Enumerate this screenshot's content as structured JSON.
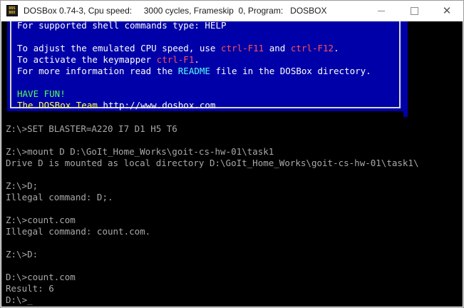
{
  "window": {
    "title": "DOSBox 0.74-3, Cpu speed:     3000 cycles, Frameskip  0, Program:   DOSBOX",
    "icon_label_top": "DOS",
    "icon_label_bottom": "BOX",
    "icon": "dosbox-app-icon",
    "controls": [
      "minimize-icon",
      "maximize-icon",
      "close-icon"
    ]
  },
  "banner": {
    "lines": [
      {
        "segments": [
          {
            "text": "For supported shell commands type: HELP",
            "color": "white"
          }
        ]
      },
      {
        "segments": []
      },
      {
        "segments": [
          {
            "text": "To adjust the emulated CPU speed, use ",
            "color": "white"
          },
          {
            "text": "ctrl-F11",
            "color": "red"
          },
          {
            "text": " and ",
            "color": "white"
          },
          {
            "text": "ctrl-F12",
            "color": "red"
          },
          {
            "text": ".",
            "color": "white"
          }
        ]
      },
      {
        "segments": [
          {
            "text": "To activate the keymapper ",
            "color": "white"
          },
          {
            "text": "ctrl-F1",
            "color": "red"
          },
          {
            "text": ".",
            "color": "white"
          }
        ]
      },
      {
        "segments": [
          {
            "text": "For more information read the ",
            "color": "white"
          },
          {
            "text": "README",
            "color": "cyan"
          },
          {
            "text": " file in the DOSBox directory.",
            "color": "white"
          }
        ]
      },
      {
        "segments": []
      },
      {
        "segments": [
          {
            "text": "HAVE FUN!",
            "color": "green"
          }
        ]
      },
      {
        "segments": [
          {
            "text": "The DOSBox Team ",
            "color": "yellow"
          },
          {
            "text": "http://www.dosbox.com",
            "color": "white"
          }
        ]
      }
    ]
  },
  "console": {
    "lines": [
      "Z:\\>SET BLASTER=A220 I7 D1 H5 T6",
      "",
      "Z:\\>mount D D:\\GoIt_Home_Works\\goit-cs-hw-01\\task1",
      "Drive D is mounted as local directory D:\\GoIt_Home_Works\\goit-cs-hw-01\\task1\\",
      "",
      "Z:\\>D;",
      "Illegal command: D;.",
      "",
      "Z:\\>count.com",
      "Illegal command: count.com.",
      "",
      "Z:\\>D:",
      "",
      "D:\\>count.com",
      "Result: 6",
      "D:\\>"
    ],
    "cursor": "_"
  },
  "colors": {
    "banner_bg": "#0000a8",
    "console_text": "#a8a8a8",
    "white": "#ffffff",
    "red": "#ff5454",
    "cyan": "#54ffff",
    "green": "#54ff54",
    "yellow": "#ffff54"
  }
}
